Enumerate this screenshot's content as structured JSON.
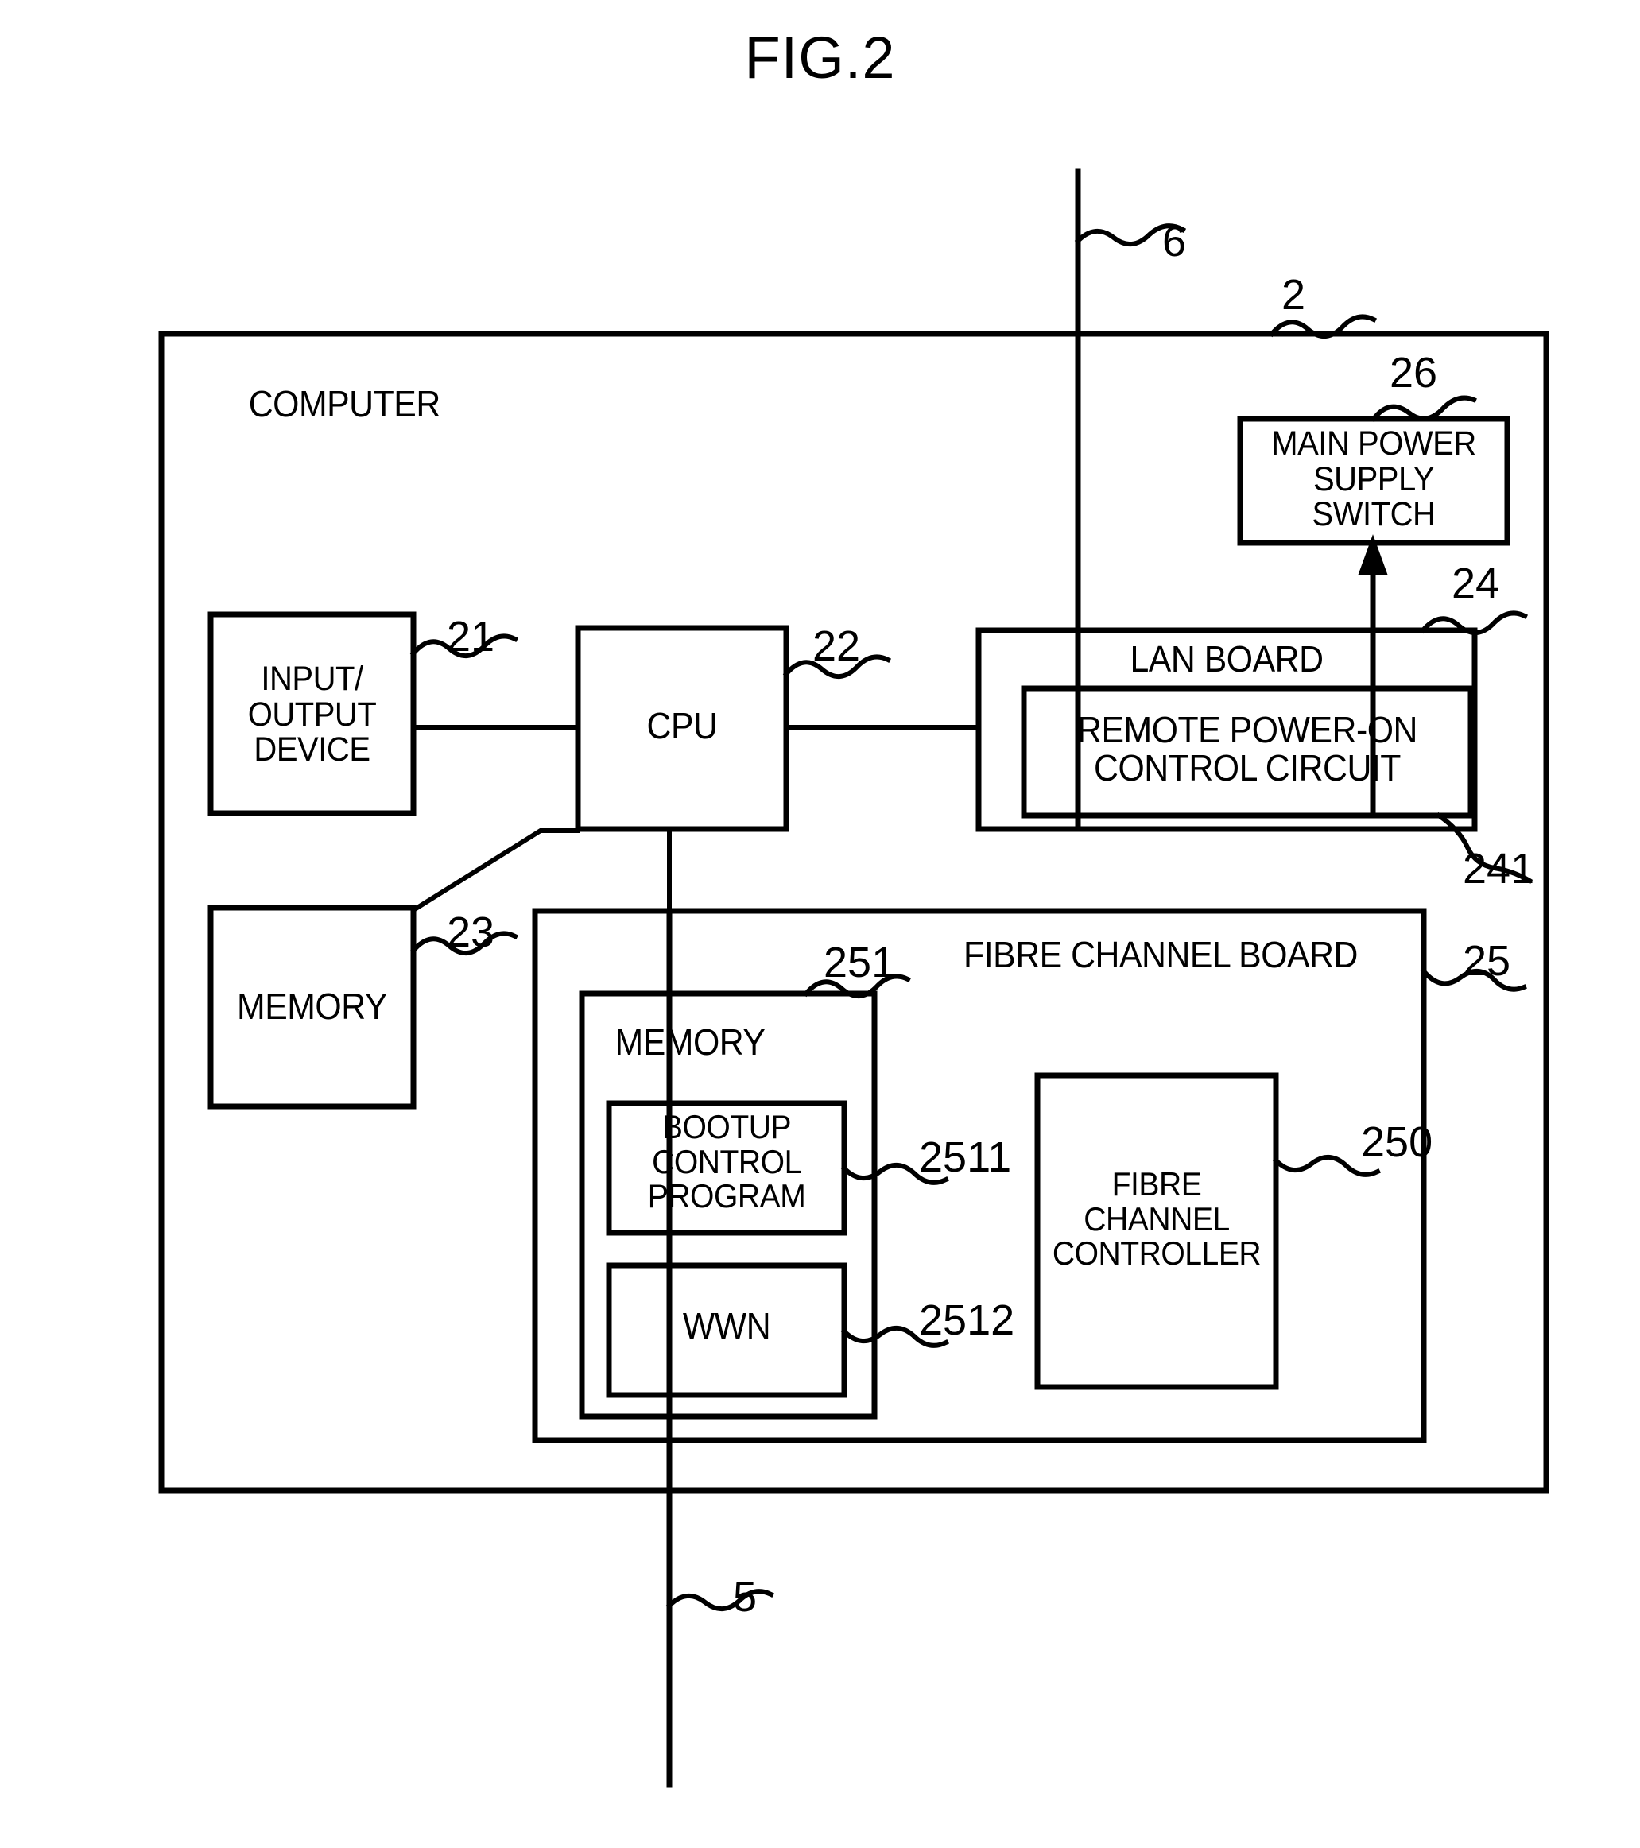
{
  "figure": {
    "title": "FIG.2"
  },
  "outer": {
    "label": "COMPUTER",
    "ref": "2"
  },
  "network_line": {
    "ref": "6"
  },
  "fibre_line": {
    "ref": "5"
  },
  "blocks": {
    "io_device": {
      "label": "INPUT/\nOUTPUT\nDEVICE",
      "ref": "21"
    },
    "cpu": {
      "label": "CPU",
      "ref": "22"
    },
    "memory": {
      "label": "MEMORY",
      "ref": "23"
    },
    "lan_board": {
      "label": "LAN BOARD",
      "ref": "24"
    },
    "remote_power_on_control_circuit": {
      "label": "REMOTE POWER-ON\nCONTROL CIRCUIT",
      "ref": "241"
    },
    "main_power_supply_switch": {
      "label": "MAIN POWER\nSUPPLY\nSWITCH",
      "ref": "26"
    },
    "fibre_channel_board": {
      "label": "FIBRE CHANNEL BOARD",
      "ref": "25"
    },
    "fc_memory": {
      "label": "MEMORY",
      "ref": "251"
    },
    "bootup_control_program": {
      "label": "BOOTUP\nCONTROL\nPROGRAM",
      "ref": "2511"
    },
    "wwn": {
      "label": "WWN",
      "ref": "2512"
    },
    "fibre_channel_controller": {
      "label": "FIBRE\nCHANNEL\nCONTROLLER",
      "ref": "250"
    }
  },
  "colors": {
    "ink": "#000000",
    "paper": "#ffffff"
  }
}
